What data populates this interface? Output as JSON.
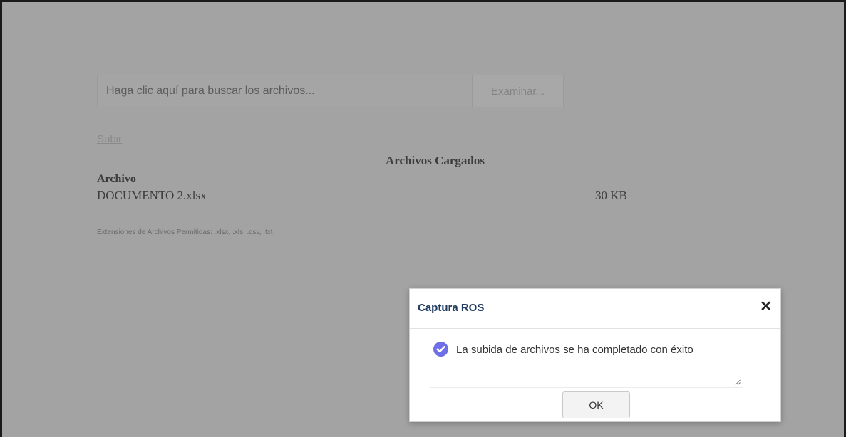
{
  "upload": {
    "file_input_placeholder": "Haga clic aquí para buscar los archivos...",
    "browse_label": "Examinar...",
    "upload_link": "Subir"
  },
  "uploaded_files": {
    "title": "Archivos Cargados",
    "column_header": "Archivo",
    "rows": [
      {
        "name": "DOCUMENTO 2.xlsx",
        "size": "30 KB"
      }
    ]
  },
  "allowed_extensions": "Extensiones de Archivos Permitidas: .xlsx, .xls, .csv, .txt",
  "dialog": {
    "title": "Captura ROS",
    "close_icon": "close-icon",
    "message": "La subida de archivos se ha completado con éxito",
    "status_icon": "check-circle-icon",
    "ok_label": "OK",
    "accent_color": "#6f6fe8"
  }
}
